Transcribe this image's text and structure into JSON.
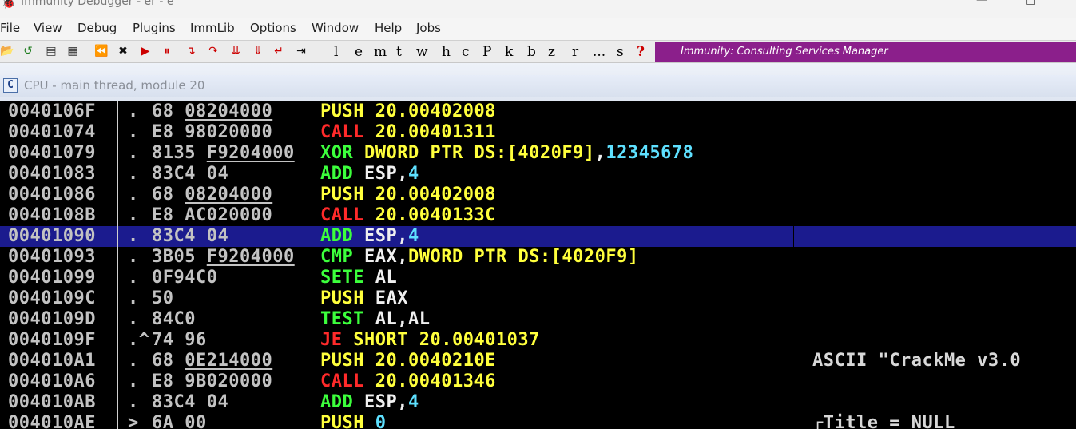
{
  "window": {
    "title": "Immunity Debugger - er - e"
  },
  "menu": [
    "File",
    "View",
    "Debug",
    "Plugins",
    "ImmLib",
    "Options",
    "Window",
    "Help",
    "Jobs"
  ],
  "toolbar": {
    "icons": [
      "open-icon",
      "restart-icon",
      "list-icon",
      "grid-icon",
      "rewind-icon",
      "close-icon",
      "run-icon",
      "pause-icon",
      "step-into-icon",
      "step-over-icon",
      "trace-into-icon",
      "trace-over-icon",
      "execute-till-return-icon",
      "goto-icon"
    ],
    "letters": [
      "l",
      "e",
      "m",
      "t",
      "w",
      "h",
      "c",
      "P",
      "k",
      "b",
      "z",
      "r",
      "...",
      "s",
      "?"
    ],
    "banner": "Immunity: Consulting Services Manager"
  },
  "cpu_window": {
    "title": "CPU - main thread, module 20",
    "icon_letter": "C"
  },
  "disassembly": {
    "selected_index": 6,
    "rows": [
      {
        "addr": "0040106F",
        "mark": ".",
        "hex_pre": "68 ",
        "hex_u": "08204000",
        "mnem": "PUSH",
        "mcolor": "yellow",
        "ops": [
          [
            "20.00402008",
            "yellow"
          ]
        ],
        "comment": ""
      },
      {
        "addr": "00401074",
        "mark": ".",
        "hex_pre": "E8 98020000",
        "hex_u": "",
        "mnem": "CALL",
        "mcolor": "red",
        "ops": [
          [
            "20.00401311",
            "yellow"
          ]
        ],
        "comment": ""
      },
      {
        "addr": "00401079",
        "mark": ".",
        "hex_pre": "8135 ",
        "hex_u": "F9204000",
        "mnem": "XOR",
        "mcolor": "green",
        "ops": [
          [
            "DWORD PTR DS:[4020F9]",
            "yellow"
          ],
          [
            ",",
            "white"
          ],
          [
            "12345678",
            "cyan"
          ]
        ],
        "comment": ""
      },
      {
        "addr": "00401083",
        "mark": ".",
        "hex_pre": "83C4 04",
        "hex_u": "",
        "mnem": "ADD",
        "mcolor": "green",
        "ops": [
          [
            "ESP",
            "white"
          ],
          [
            ",",
            "white"
          ],
          [
            "4",
            "cyan"
          ]
        ],
        "comment": ""
      },
      {
        "addr": "00401086",
        "mark": ".",
        "hex_pre": "68 ",
        "hex_u": "08204000",
        "mnem": "PUSH",
        "mcolor": "yellow",
        "ops": [
          [
            "20.00402008",
            "yellow"
          ]
        ],
        "comment": ""
      },
      {
        "addr": "0040108B",
        "mark": ".",
        "hex_pre": "E8 AC020000",
        "hex_u": "",
        "mnem": "CALL",
        "mcolor": "red",
        "ops": [
          [
            "20.0040133C",
            "yellow"
          ]
        ],
        "comment": ""
      },
      {
        "addr": "00401090",
        "mark": ".",
        "hex_pre": "83C4 04",
        "hex_u": "",
        "mnem": "ADD",
        "mcolor": "green",
        "ops": [
          [
            "ESP",
            "white"
          ],
          [
            ",",
            "white"
          ],
          [
            "4",
            "cyan"
          ]
        ],
        "comment": ""
      },
      {
        "addr": "00401093",
        "mark": ".",
        "hex_pre": "3B05 ",
        "hex_u": "F9204000",
        "mnem": "CMP",
        "mcolor": "green",
        "ops": [
          [
            "EAX",
            "white"
          ],
          [
            ",",
            "white"
          ],
          [
            "DWORD PTR DS:[4020F9]",
            "yellow"
          ]
        ],
        "comment": ""
      },
      {
        "addr": "00401099",
        "mark": ".",
        "hex_pre": "0F94C0",
        "hex_u": "",
        "mnem": "SETE",
        "mcolor": "green",
        "ops": [
          [
            "AL",
            "white"
          ]
        ],
        "comment": ""
      },
      {
        "addr": "0040109C",
        "mark": ".",
        "hex_pre": "50",
        "hex_u": "",
        "mnem": "PUSH",
        "mcolor": "yellow",
        "ops": [
          [
            "EAX",
            "white"
          ]
        ],
        "comment": ""
      },
      {
        "addr": "0040109D",
        "mark": ".",
        "hex_pre": "84C0",
        "hex_u": "",
        "mnem": "TEST",
        "mcolor": "green",
        "ops": [
          [
            "AL",
            "white"
          ],
          [
            ",",
            "white"
          ],
          [
            "AL",
            "white"
          ]
        ],
        "comment": ""
      },
      {
        "addr": "0040109F",
        "mark": ".^",
        "hex_pre": "74 96",
        "hex_u": "",
        "mnem": "JE",
        "mcolor": "red",
        "ops": [
          [
            "SHORT 20.00401037",
            "yellow"
          ]
        ],
        "comment": ""
      },
      {
        "addr": "004010A1",
        "mark": ".",
        "hex_pre": "68 ",
        "hex_u": "0E214000",
        "mnem": "PUSH",
        "mcolor": "yellow",
        "ops": [
          [
            "20.0040210E",
            "yellow"
          ]
        ],
        "comment": "ASCII \"CrackMe v3.0"
      },
      {
        "addr": "004010A6",
        "mark": ".",
        "hex_pre": "E8 9B020000",
        "hex_u": "",
        "mnem": "CALL",
        "mcolor": "red",
        "ops": [
          [
            "20.00401346",
            "yellow"
          ]
        ],
        "comment": ""
      },
      {
        "addr": "004010AB",
        "mark": ".",
        "hex_pre": "83C4 04",
        "hex_u": "",
        "mnem": "ADD",
        "mcolor": "green",
        "ops": [
          [
            "ESP",
            "white"
          ],
          [
            ",",
            "white"
          ],
          [
            "4",
            "cyan"
          ]
        ],
        "comment": ""
      },
      {
        "addr": "004010AE",
        "mark": ">",
        "hex_pre": "6A 00",
        "hex_u": "",
        "mnem": "PUSH",
        "mcolor": "yellow",
        "ops": [
          [
            "0",
            "cyan"
          ]
        ],
        "comment": "┌Title = NULL"
      }
    ]
  }
}
